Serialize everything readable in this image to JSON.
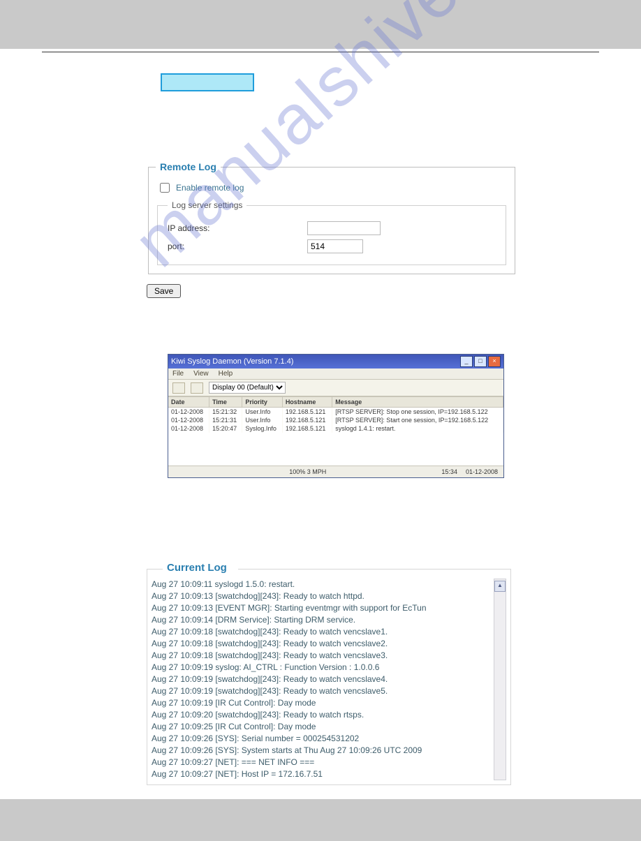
{
  "watermark": "manualshive.com",
  "remote_log": {
    "legend": "Remote Log",
    "enable_label": "Enable remote log",
    "enable_checked": false,
    "server_legend": "Log server settings",
    "ip_label": "IP address:",
    "ip_value": "",
    "port_label": "port:",
    "port_value": "514",
    "save_label": "Save"
  },
  "kiwi": {
    "title": "Kiwi Syslog Daemon (Version 7.1.4)",
    "menu": [
      "File",
      "View",
      "Help"
    ],
    "dropdown": "Display 00 (Default)",
    "columns": [
      "Date",
      "Time",
      "Priority",
      "Hostname",
      "Message"
    ],
    "rows": [
      {
        "date": "01-12-2008",
        "time": "15:21:32",
        "priority": "User.Info",
        "host": "192.168.5.121",
        "msg": "[RTSP SERVER]: Stop one session, IP=192.168.5.122"
      },
      {
        "date": "01-12-2008",
        "time": "15:21:31",
        "priority": "User.Info",
        "host": "192.168.5.121",
        "msg": "[RTSP SERVER]: Start one session, IP=192.168.5.122"
      },
      {
        "date": "01-12-2008",
        "time": "15:20:47",
        "priority": "Syslog.Info",
        "host": "192.168.5.121",
        "msg": "syslogd 1.4.1: restart."
      }
    ],
    "status_mid": "100%   3 MPH",
    "status_time": "15:34",
    "status_date": "01-12-2008"
  },
  "current_log": {
    "legend": "Current Log",
    "lines": [
      "Aug 27 10:09:11 syslogd 1.5.0: restart.",
      "Aug 27 10:09:13 [swatchdog][243]: Ready to watch httpd.",
      "Aug 27 10:09:13 [EVENT MGR]: Starting eventmgr with support for EcTun",
      "Aug 27 10:09:14 [DRM Service]: Starting DRM service.",
      "Aug 27 10:09:18 [swatchdog][243]: Ready to watch vencslave1.",
      "Aug 27 10:09:18 [swatchdog][243]: Ready to watch vencslave2.",
      "Aug 27 10:09:18 [swatchdog][243]: Ready to watch vencslave3.",
      "Aug 27 10:09:19 syslog: AI_CTRL : Function Version : 1.0.0.6",
      "Aug 27 10:09:19 [swatchdog][243]: Ready to watch vencslave4.",
      "Aug 27 10:09:19 [swatchdog][243]: Ready to watch vencslave5.",
      "Aug 27 10:09:19 [IR Cut Control]: Day mode",
      "Aug 27 10:09:20 [swatchdog][243]: Ready to watch rtsps.",
      "Aug 27 10:09:25 [IR Cut Control]: Day mode",
      "Aug 27 10:09:26 [SYS]: Serial number = 000254531202",
      "Aug 27 10:09:26 [SYS]: System starts at Thu Aug 27 10:09:26 UTC 2009",
      "Aug 27 10:09:27 [NET]: === NET INFO ===",
      "Aug 27 10:09:27 [NET]: Host IP = 172.16.7.51"
    ]
  }
}
